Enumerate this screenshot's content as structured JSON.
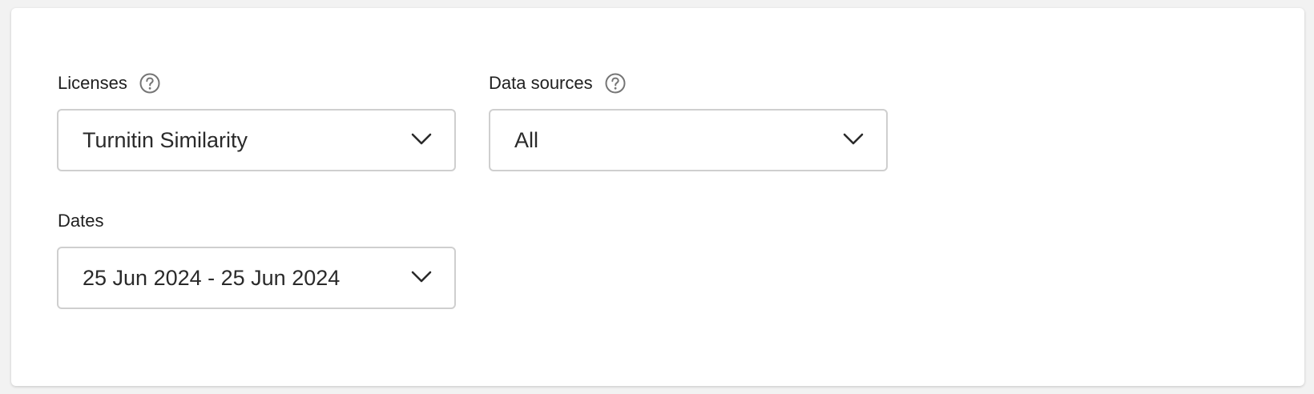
{
  "filters": {
    "licenses": {
      "label": "Licenses",
      "help_icon": "help-circle-icon",
      "value": "Turnitin Similarity"
    },
    "data_sources": {
      "label": "Data sources",
      "help_icon": "help-circle-icon",
      "value": "All"
    },
    "dates": {
      "label": "Dates",
      "value": "25 Jun 2024 - 25 Jun 2024"
    }
  },
  "icons": {
    "dropdown": "chevron-down-icon"
  },
  "colors": {
    "card_background": "#ffffff",
    "page_background": "#f2f2f2",
    "border": "#cfcfcf",
    "text": "#1f1f1f",
    "icon": "#757575"
  }
}
